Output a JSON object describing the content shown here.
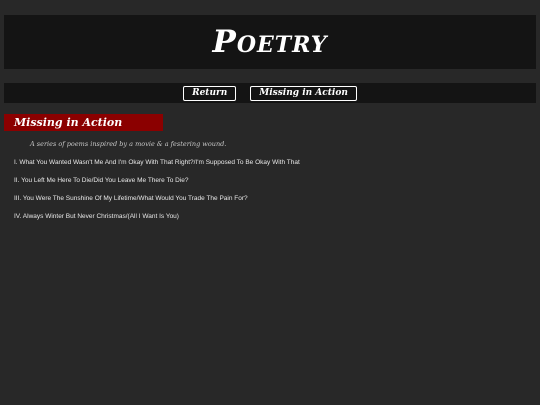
{
  "header": {
    "title": "Poetry"
  },
  "nav": {
    "return_label": "Return",
    "current_label": "Missing in Action"
  },
  "section": {
    "title": "Missing in Action",
    "description": "A series of poems inspired by a movie & a festering wound."
  },
  "poems": [
    {
      "label": "I. What You Wanted Wasn't Me And I'm Okay With That Right?/I'm Supposed To Be Okay With That"
    },
    {
      "label": "II. You Left Me Here To Die/Did You Leave Me There To Die?"
    },
    {
      "label": "III. You Were The Sunshine Of My Lifetime/What Would You Trade The Pain For?"
    },
    {
      "label": "IV. Always Winter But Never Christmas/(All I Want Is You)"
    }
  ],
  "colors": {
    "background": "#282828",
    "header_bg": "#141414",
    "banner": "#8b0000",
    "text": "#e8e8e8"
  }
}
